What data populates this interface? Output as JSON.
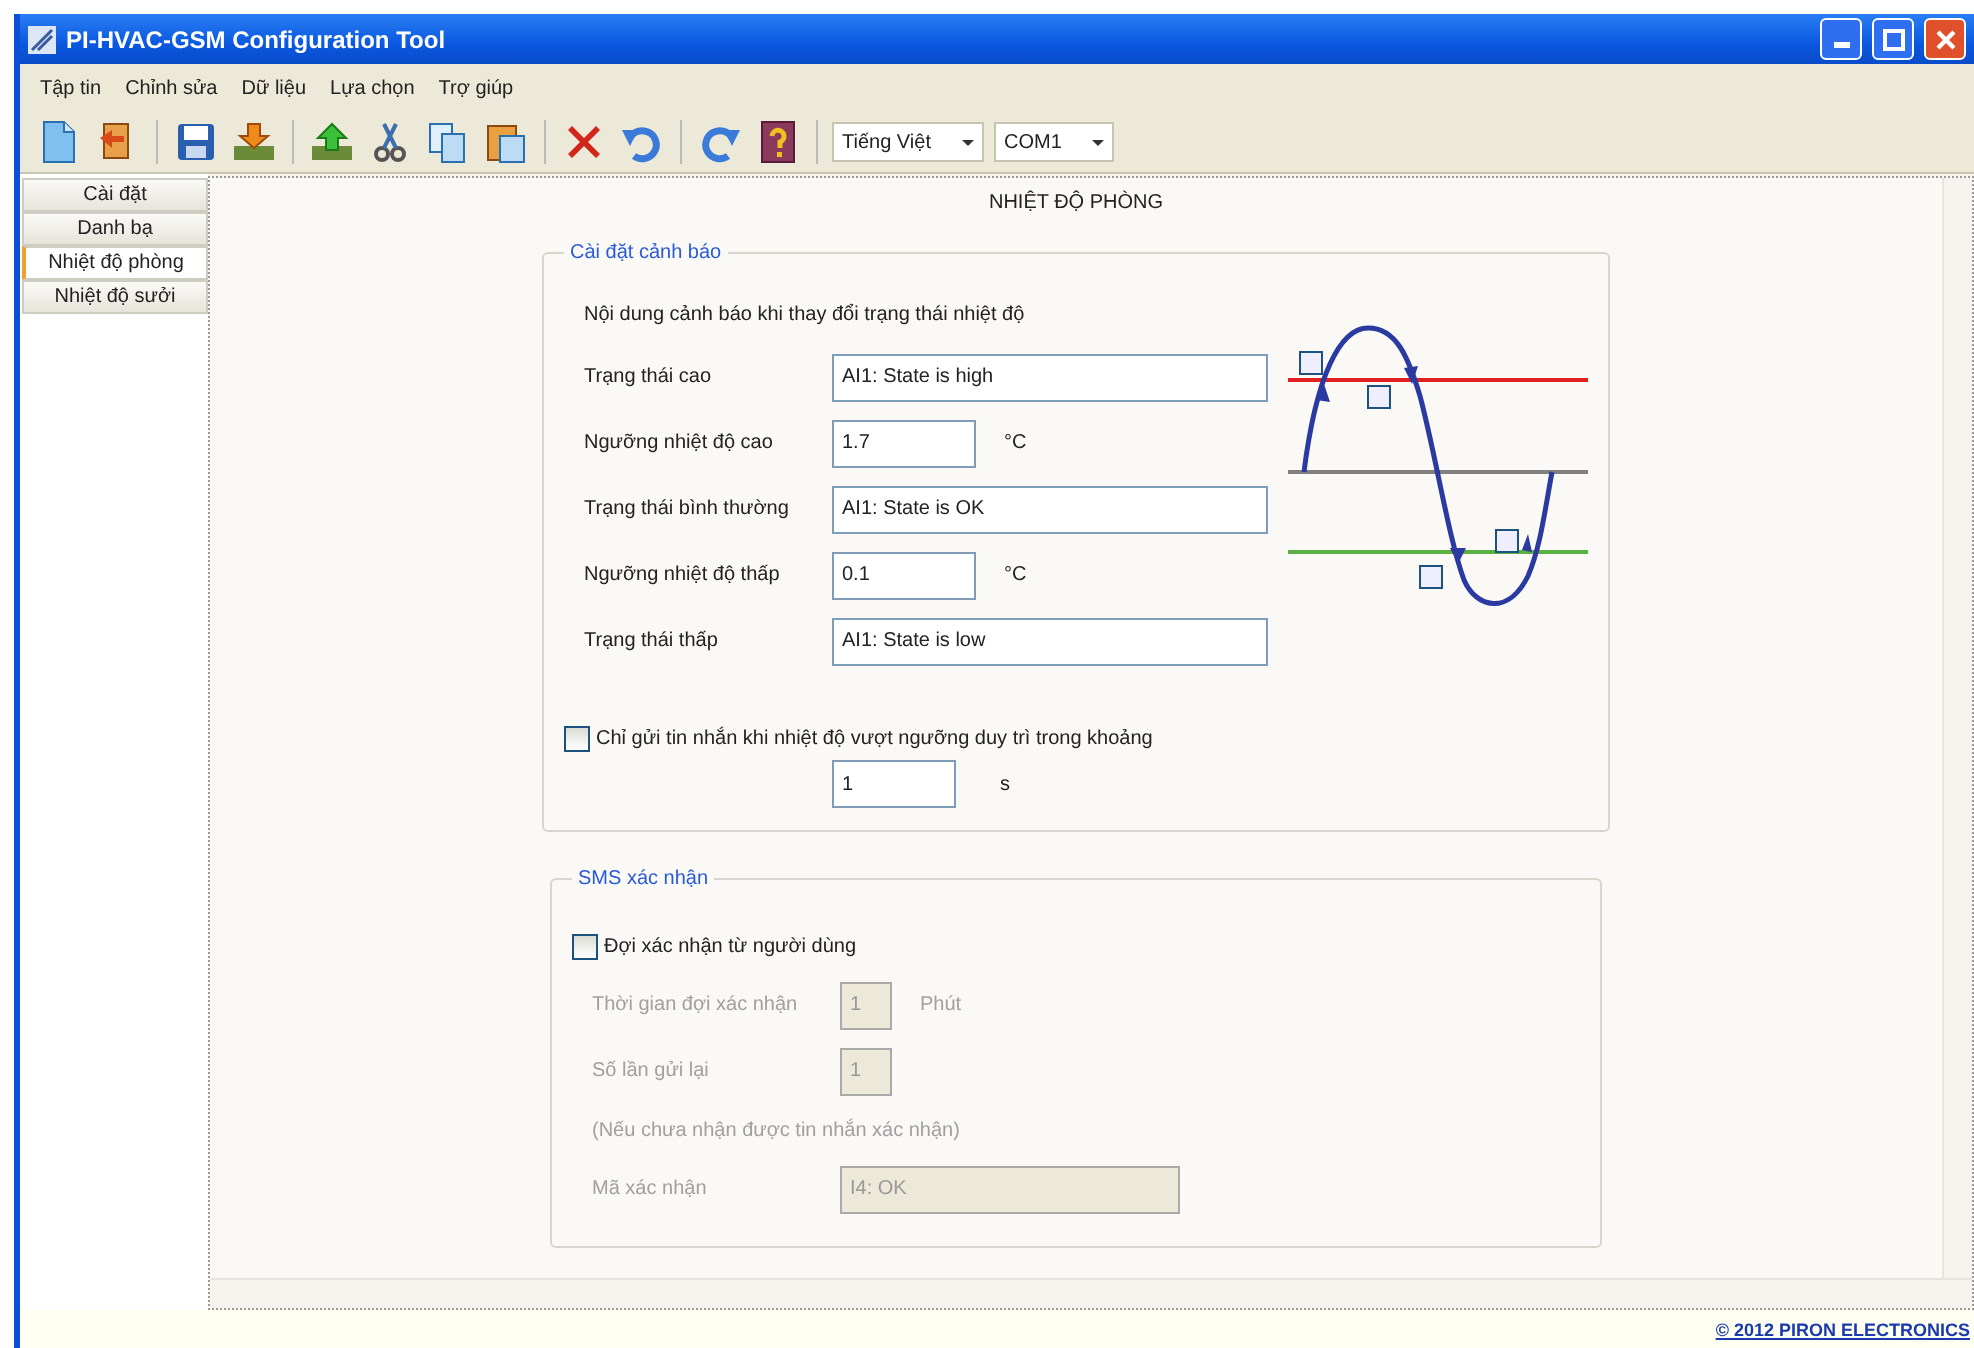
{
  "window": {
    "title": "PI-HVAC-GSM Configuration Tool"
  },
  "menu": [
    "Tập tin",
    "Chỉnh sửa",
    "Dữ liệu",
    "Lựa chọn",
    "Trợ giúp"
  ],
  "toolbar": {
    "language": "Tiếng Việt",
    "port": "COM1"
  },
  "tabs": [
    {
      "label": "Cài đặt",
      "selected": false
    },
    {
      "label": "Danh bạ",
      "selected": false
    },
    {
      "label": "Nhiệt độ phòng",
      "selected": true
    },
    {
      "label": "Nhiệt độ sưởi",
      "selected": false
    }
  ],
  "page_title": "NHIỆT ĐỘ PHÒNG",
  "alarm_group": {
    "title": "Cài đặt cảnh báo",
    "description": "Nội dung cảnh báo khi thay đổi trạng thái nhiệt độ",
    "fields": [
      {
        "kind": "wide",
        "label": "Trạng thái cao",
        "value": "AI1: State is high"
      },
      {
        "kind": "number",
        "label": "Ngưỡng nhiệt độ cao",
        "value": "1.7",
        "unit": "°C"
      },
      {
        "kind": "wide",
        "label": "Trạng thái bình thường",
        "value": "AI1: State is OK"
      },
      {
        "kind": "number",
        "label": "Ngưỡng nhiệt độ thấp",
        "value": "0.1",
        "unit": "°C"
      },
      {
        "kind": "wide",
        "label": "Trạng thái thấp",
        "value": "AI1: State is low"
      }
    ],
    "hold_option": {
      "label": "Chỉ gửi tin nhắn khi nhiệt độ vượt ngưỡng duy trì trong khoảng",
      "checked": false,
      "value": "1",
      "unit": "s"
    }
  },
  "confirm_group": {
    "title": "SMS xác nhận",
    "wait_option": {
      "label": "Đợi xác nhận từ người dùng",
      "checked": false
    },
    "fields": [
      {
        "kind": "short",
        "label": "Thời gian đợi xác nhận",
        "value": "1",
        "unit": "Phút",
        "disabled": true
      },
      {
        "kind": "short",
        "label": "Số lần gửi lại",
        "value": "1",
        "disabled": true
      },
      {
        "kind": "note",
        "label": "(Nếu chưa nhận được tin nhắn xác nhận)",
        "disabled": true
      },
      {
        "kind": "code",
        "label": "Mã xác nhận",
        "value": "I4: OK",
        "disabled": true
      }
    ]
  },
  "footer": {
    "copyright": "© 2012 PIRON ELECTRONICS"
  }
}
